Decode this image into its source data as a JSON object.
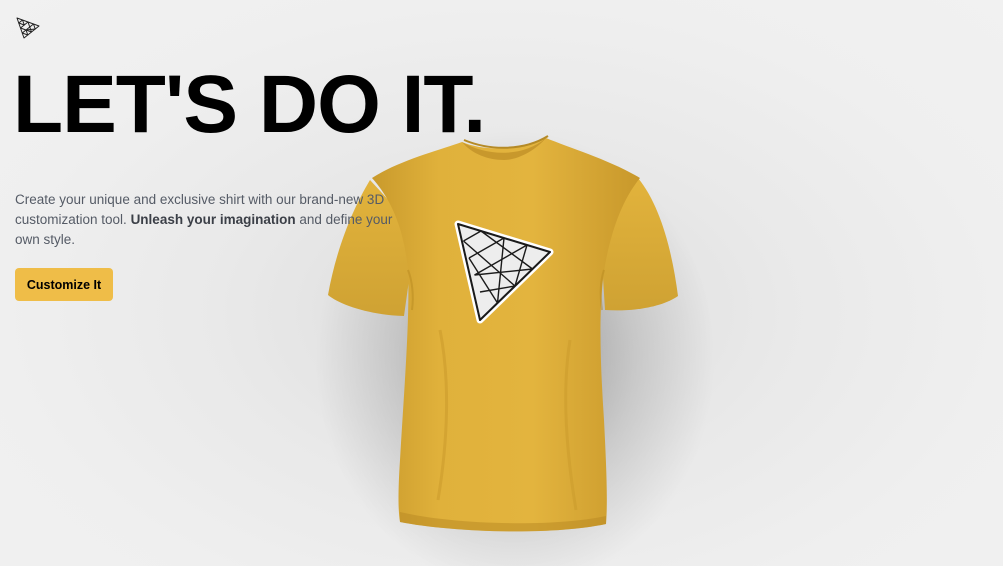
{
  "header": {
    "logo_icon": "triangle-mesh-logo-icon"
  },
  "hero": {
    "headline": "LET'S DO IT.",
    "description_lead": "Create your unique and exclusive shirt with our brand-new 3D customization tool. ",
    "description_strong": "Unleash your imagination",
    "description_tail": " and define your own style.",
    "cta_label": "Customize It"
  },
  "shirt": {
    "color": "#E2B33C",
    "decal_icon": "triangle-mesh-decal-icon"
  },
  "colors": {
    "accent": "#EFBD48",
    "headline": "#000000",
    "body_text": "#555b66"
  }
}
